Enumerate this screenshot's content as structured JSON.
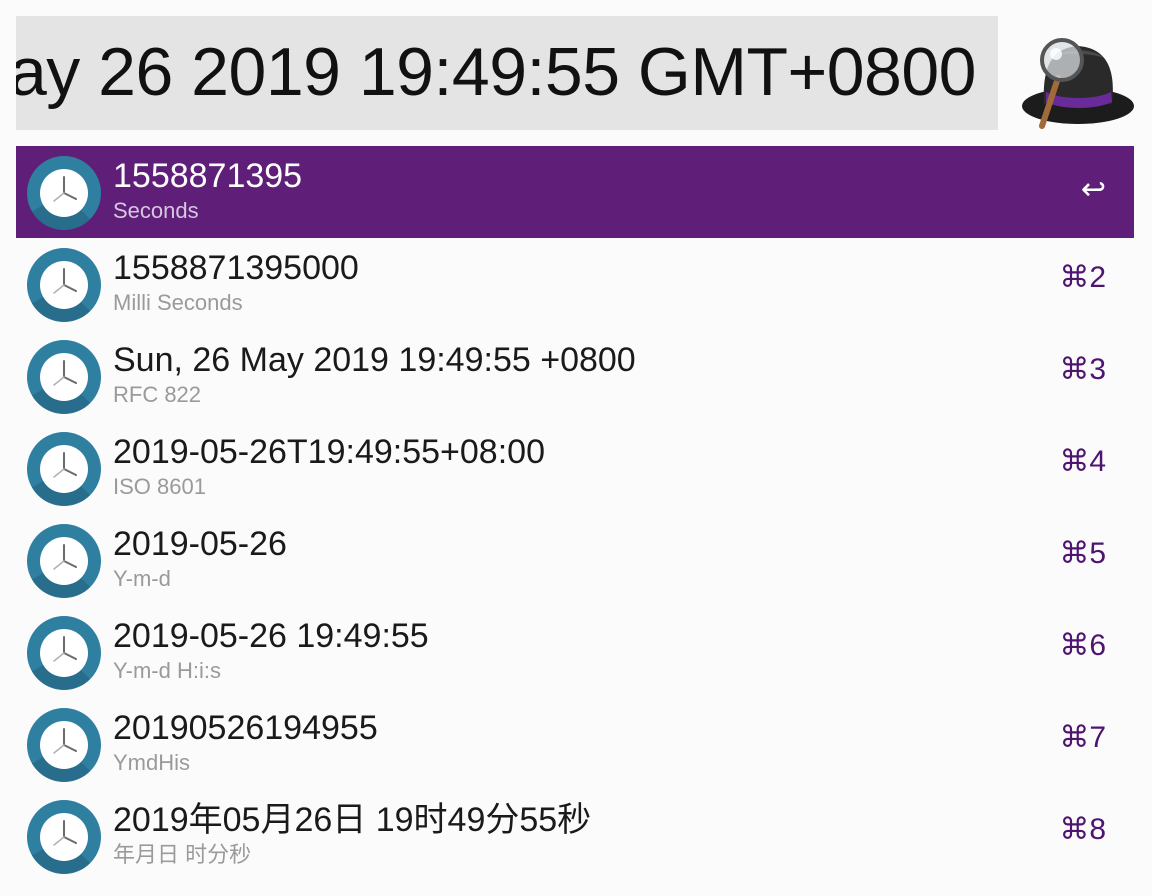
{
  "search": {
    "query": "ay 26 2019 19:49:55 GMT+0800"
  },
  "logo": {
    "icon": "alfred-hat-icon"
  },
  "colors": {
    "selected_row": "#5f1f78",
    "shortcut": "#4e1470",
    "clock_icon": "#2f7fa1"
  },
  "results": [
    {
      "title": "1558871395",
      "subtitle": "Seconds",
      "shortcut": "↩",
      "selected": true
    },
    {
      "title": "1558871395000",
      "subtitle": "Milli Seconds",
      "shortcut": "⌘2"
    },
    {
      "title": "Sun, 26 May 2019 19:49:55 +0800",
      "subtitle": "RFC 822",
      "shortcut": "⌘3"
    },
    {
      "title": "2019-05-26T19:49:55+08:00",
      "subtitle": "ISO 8601",
      "shortcut": "⌘4"
    },
    {
      "title": "2019-05-26",
      "subtitle": "Y-m-d",
      "shortcut": "⌘5"
    },
    {
      "title": "2019-05-26 19:49:55",
      "subtitle": "Y-m-d H:i:s",
      "shortcut": "⌘6"
    },
    {
      "title": "20190526194955",
      "subtitle": "YmdHis",
      "shortcut": "⌘7"
    },
    {
      "title": "2019年05月26日 19时49分55秒",
      "subtitle": "年月日 时分秒",
      "shortcut": "⌘8"
    }
  ]
}
